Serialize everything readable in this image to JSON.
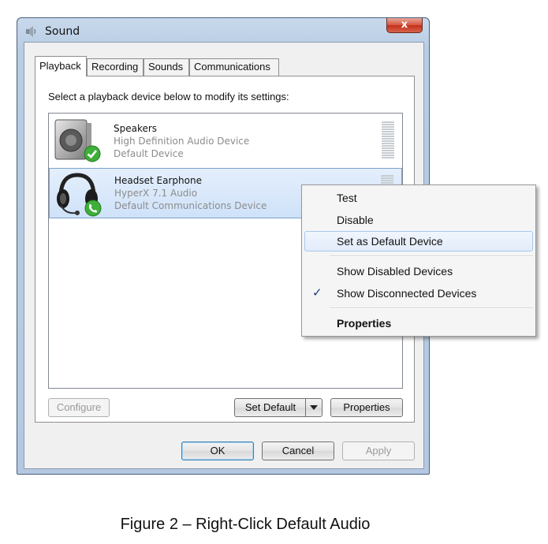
{
  "window": {
    "title": "Sound",
    "close_glyph": "x",
    "title_icon": "speaker-icon"
  },
  "tabs": [
    {
      "label": "Playback",
      "active": true
    },
    {
      "label": "Recording",
      "active": false
    },
    {
      "label": "Sounds",
      "active": false
    },
    {
      "label": "Communications",
      "active": false
    }
  ],
  "instructions": "Select a playback device below to modify its settings:",
  "devices": [
    {
      "name": "Speakers",
      "line1": "High Definition Audio Device",
      "line2": "Default Device",
      "icon": "speaker-device-icon",
      "badge": "green-check-icon",
      "selected": false
    },
    {
      "name": "Headset Earphone",
      "line1": "HyperX 7.1 Audio",
      "line2": "Default Communications Device",
      "icon": "headset-device-icon",
      "badge": "green-phone-icon",
      "selected": true
    }
  ],
  "buttons": {
    "configure": "Configure",
    "set_default": "Set Default",
    "properties": "Properties",
    "ok": "OK",
    "cancel": "Cancel",
    "apply": "Apply"
  },
  "context_menu": {
    "items": [
      {
        "label": "Test"
      },
      {
        "label": "Disable"
      },
      {
        "label": "Set as Default Device",
        "highlighted": true
      },
      {
        "label": "Show Disabled Devices"
      },
      {
        "label": "Show Disconnected Devices",
        "checked": true
      },
      {
        "label": "Properties",
        "bold": true
      }
    ],
    "check_glyph": "✓"
  },
  "caption": "Figure 2 – Right-Click Default Audio",
  "colors": {
    "selection": "#cfe2f9",
    "badge_green": "#3fae3a",
    "close_red": "#c4301b"
  }
}
